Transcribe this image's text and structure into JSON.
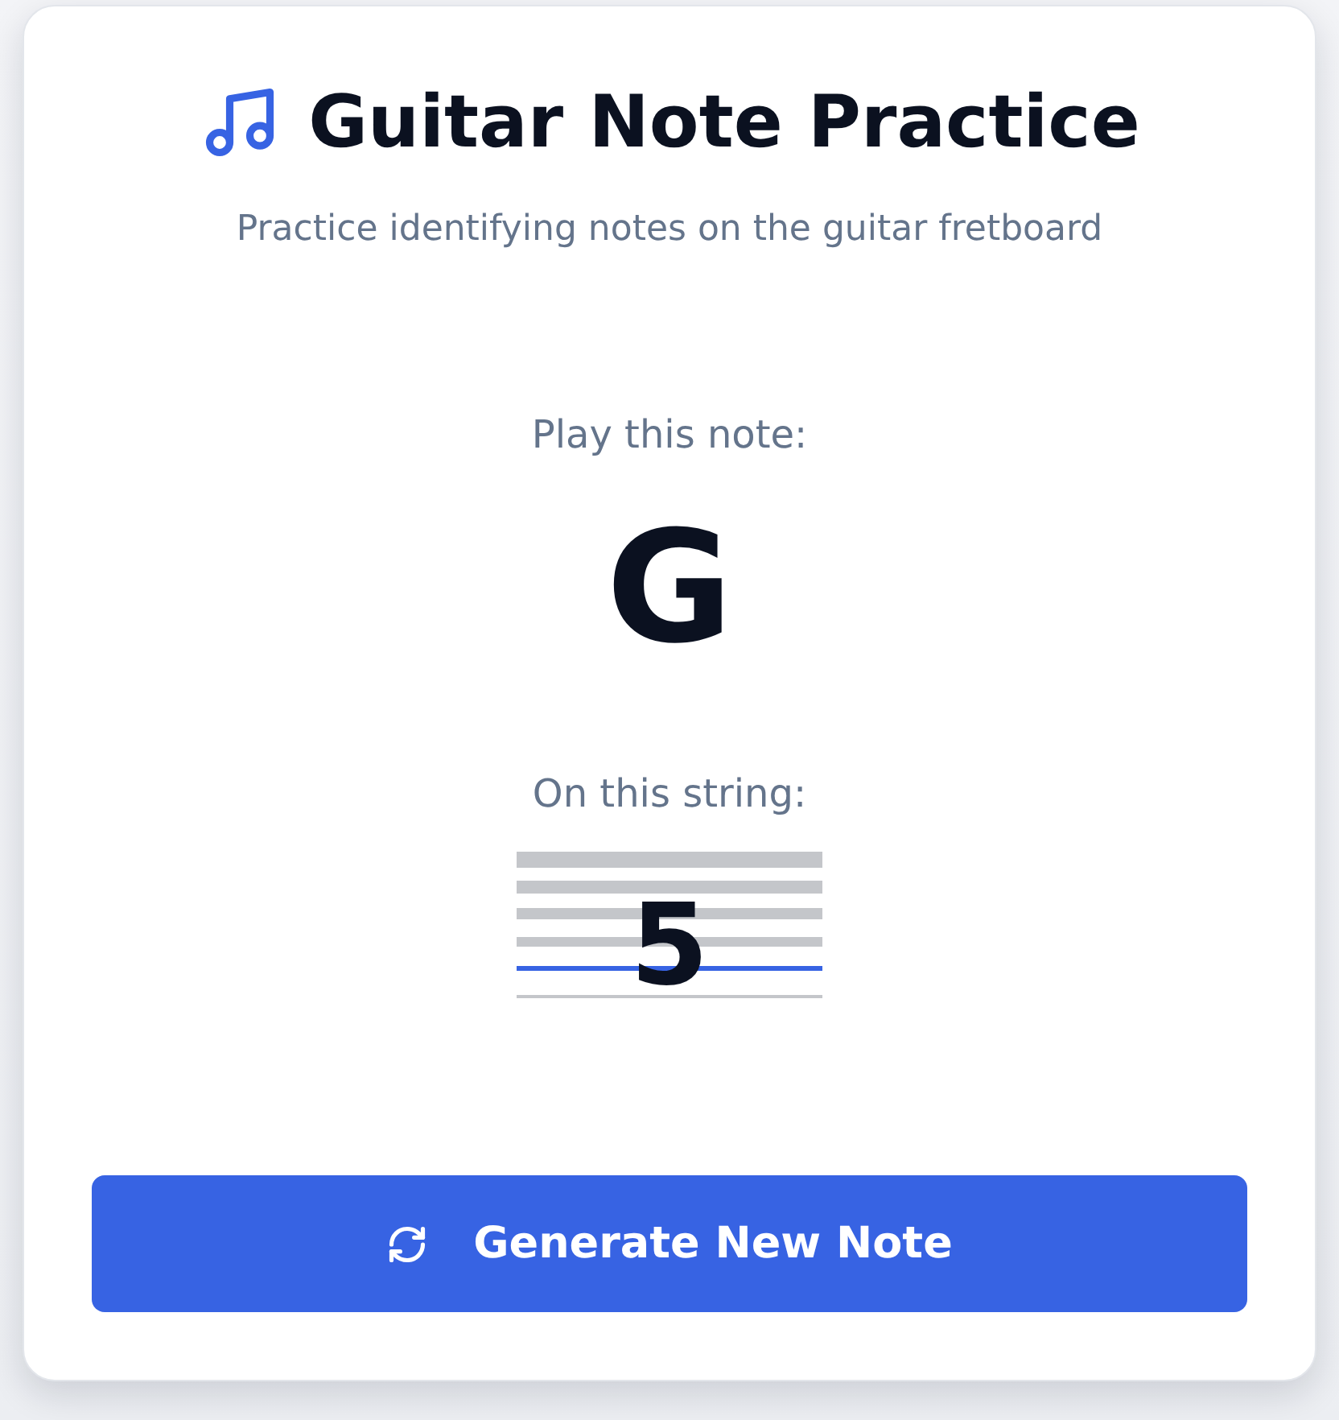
{
  "header": {
    "title": "Guitar Note Practice",
    "subtitle": "Practice identifying notes on the guitar fretboard"
  },
  "prompt": {
    "note_label": "Play this note:",
    "note": "G",
    "string_label": "On this string:",
    "string_number": "5"
  },
  "strings": [
    {
      "selected": false
    },
    {
      "selected": false
    },
    {
      "selected": false
    },
    {
      "selected": false
    },
    {
      "selected": true
    },
    {
      "selected": false
    }
  ],
  "button": {
    "label": "Generate New Note"
  }
}
